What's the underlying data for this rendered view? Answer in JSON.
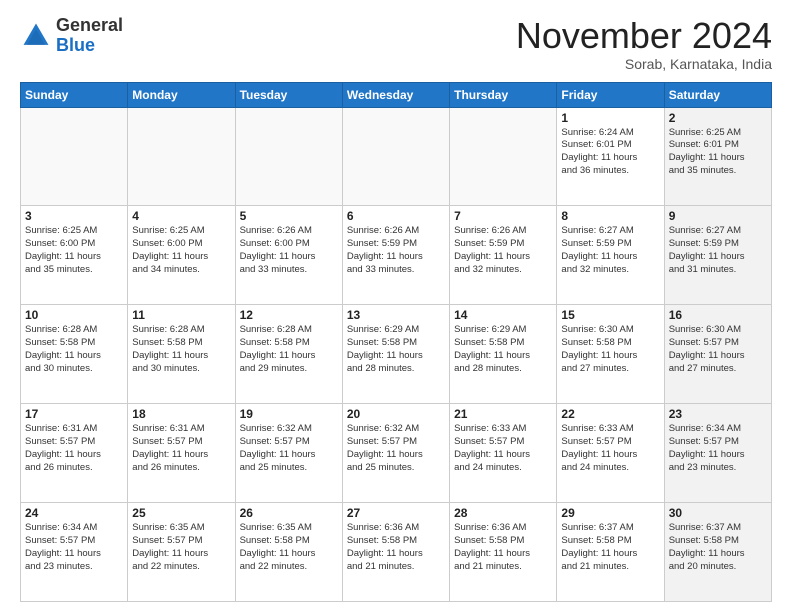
{
  "header": {
    "logo_general": "General",
    "logo_blue": "Blue",
    "month_title": "November 2024",
    "subtitle": "Sorab, Karnataka, India"
  },
  "weekdays": [
    "Sunday",
    "Monday",
    "Tuesday",
    "Wednesday",
    "Thursday",
    "Friday",
    "Saturday"
  ],
  "weeks": [
    [
      {
        "day": "",
        "info": "",
        "empty": true
      },
      {
        "day": "",
        "info": "",
        "empty": true
      },
      {
        "day": "",
        "info": "",
        "empty": true
      },
      {
        "day": "",
        "info": "",
        "empty": true
      },
      {
        "day": "",
        "info": "",
        "empty": true
      },
      {
        "day": "1",
        "info": "Sunrise: 6:24 AM\nSunset: 6:01 PM\nDaylight: 11 hours\nand 36 minutes.",
        "shaded": false
      },
      {
        "day": "2",
        "info": "Sunrise: 6:25 AM\nSunset: 6:01 PM\nDaylight: 11 hours\nand 35 minutes.",
        "shaded": true
      }
    ],
    [
      {
        "day": "3",
        "info": "Sunrise: 6:25 AM\nSunset: 6:00 PM\nDaylight: 11 hours\nand 35 minutes.",
        "shaded": false
      },
      {
        "day": "4",
        "info": "Sunrise: 6:25 AM\nSunset: 6:00 PM\nDaylight: 11 hours\nand 34 minutes.",
        "shaded": false
      },
      {
        "day": "5",
        "info": "Sunrise: 6:26 AM\nSunset: 6:00 PM\nDaylight: 11 hours\nand 33 minutes.",
        "shaded": false
      },
      {
        "day": "6",
        "info": "Sunrise: 6:26 AM\nSunset: 5:59 PM\nDaylight: 11 hours\nand 33 minutes.",
        "shaded": false
      },
      {
        "day": "7",
        "info": "Sunrise: 6:26 AM\nSunset: 5:59 PM\nDaylight: 11 hours\nand 32 minutes.",
        "shaded": false
      },
      {
        "day": "8",
        "info": "Sunrise: 6:27 AM\nSunset: 5:59 PM\nDaylight: 11 hours\nand 32 minutes.",
        "shaded": false
      },
      {
        "day": "9",
        "info": "Sunrise: 6:27 AM\nSunset: 5:59 PM\nDaylight: 11 hours\nand 31 minutes.",
        "shaded": true
      }
    ],
    [
      {
        "day": "10",
        "info": "Sunrise: 6:28 AM\nSunset: 5:58 PM\nDaylight: 11 hours\nand 30 minutes.",
        "shaded": false
      },
      {
        "day": "11",
        "info": "Sunrise: 6:28 AM\nSunset: 5:58 PM\nDaylight: 11 hours\nand 30 minutes.",
        "shaded": false
      },
      {
        "day": "12",
        "info": "Sunrise: 6:28 AM\nSunset: 5:58 PM\nDaylight: 11 hours\nand 29 minutes.",
        "shaded": false
      },
      {
        "day": "13",
        "info": "Sunrise: 6:29 AM\nSunset: 5:58 PM\nDaylight: 11 hours\nand 28 minutes.",
        "shaded": false
      },
      {
        "day": "14",
        "info": "Sunrise: 6:29 AM\nSunset: 5:58 PM\nDaylight: 11 hours\nand 28 minutes.",
        "shaded": false
      },
      {
        "day": "15",
        "info": "Sunrise: 6:30 AM\nSunset: 5:58 PM\nDaylight: 11 hours\nand 27 minutes.",
        "shaded": false
      },
      {
        "day": "16",
        "info": "Sunrise: 6:30 AM\nSunset: 5:57 PM\nDaylight: 11 hours\nand 27 minutes.",
        "shaded": true
      }
    ],
    [
      {
        "day": "17",
        "info": "Sunrise: 6:31 AM\nSunset: 5:57 PM\nDaylight: 11 hours\nand 26 minutes.",
        "shaded": false
      },
      {
        "day": "18",
        "info": "Sunrise: 6:31 AM\nSunset: 5:57 PM\nDaylight: 11 hours\nand 26 minutes.",
        "shaded": false
      },
      {
        "day": "19",
        "info": "Sunrise: 6:32 AM\nSunset: 5:57 PM\nDaylight: 11 hours\nand 25 minutes.",
        "shaded": false
      },
      {
        "day": "20",
        "info": "Sunrise: 6:32 AM\nSunset: 5:57 PM\nDaylight: 11 hours\nand 25 minutes.",
        "shaded": false
      },
      {
        "day": "21",
        "info": "Sunrise: 6:33 AM\nSunset: 5:57 PM\nDaylight: 11 hours\nand 24 minutes.",
        "shaded": false
      },
      {
        "day": "22",
        "info": "Sunrise: 6:33 AM\nSunset: 5:57 PM\nDaylight: 11 hours\nand 24 minutes.",
        "shaded": false
      },
      {
        "day": "23",
        "info": "Sunrise: 6:34 AM\nSunset: 5:57 PM\nDaylight: 11 hours\nand 23 minutes.",
        "shaded": true
      }
    ],
    [
      {
        "day": "24",
        "info": "Sunrise: 6:34 AM\nSunset: 5:57 PM\nDaylight: 11 hours\nand 23 minutes.",
        "shaded": false
      },
      {
        "day": "25",
        "info": "Sunrise: 6:35 AM\nSunset: 5:57 PM\nDaylight: 11 hours\nand 22 minutes.",
        "shaded": false
      },
      {
        "day": "26",
        "info": "Sunrise: 6:35 AM\nSunset: 5:58 PM\nDaylight: 11 hours\nand 22 minutes.",
        "shaded": false
      },
      {
        "day": "27",
        "info": "Sunrise: 6:36 AM\nSunset: 5:58 PM\nDaylight: 11 hours\nand 21 minutes.",
        "shaded": false
      },
      {
        "day": "28",
        "info": "Sunrise: 6:36 AM\nSunset: 5:58 PM\nDaylight: 11 hours\nand 21 minutes.",
        "shaded": false
      },
      {
        "day": "29",
        "info": "Sunrise: 6:37 AM\nSunset: 5:58 PM\nDaylight: 11 hours\nand 21 minutes.",
        "shaded": false
      },
      {
        "day": "30",
        "info": "Sunrise: 6:37 AM\nSunset: 5:58 PM\nDaylight: 11 hours\nand 20 minutes.",
        "shaded": true
      }
    ]
  ]
}
